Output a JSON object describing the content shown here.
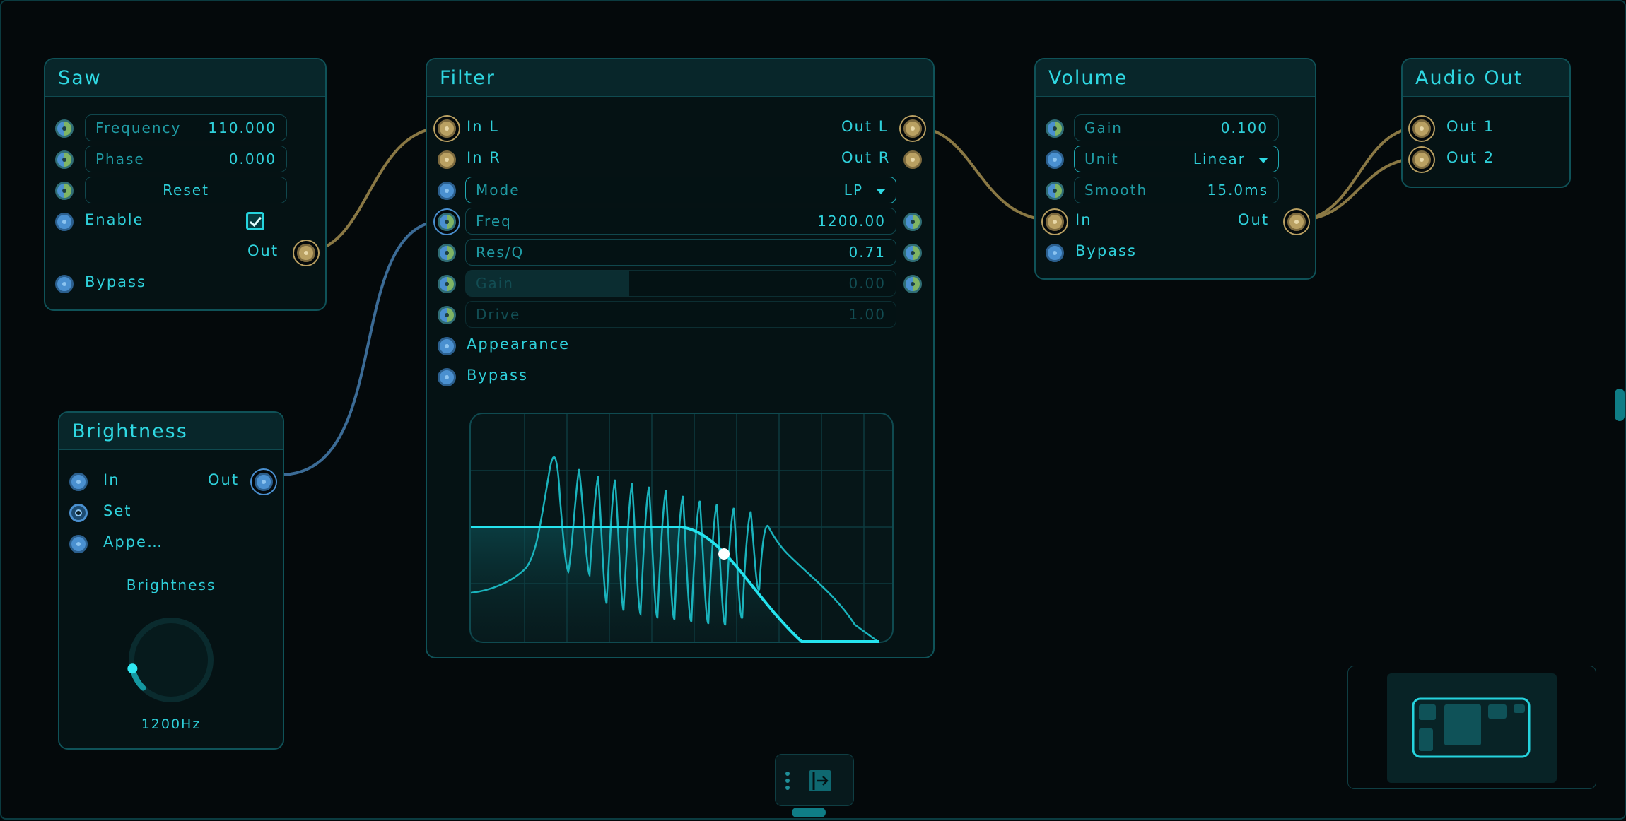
{
  "accent_color": "#25d3dd",
  "wire_colors": {
    "audio": "#8a7844",
    "control": "#3b6b96"
  },
  "nodes": {
    "saw": {
      "title": "Saw",
      "frequency": {
        "label": "Frequency",
        "value": "110.000"
      },
      "phase": {
        "label": "Phase",
        "value": "0.000"
      },
      "reset_label": "Reset",
      "enable_label": "Enable",
      "enable_checked": true,
      "out_label": "Out",
      "bypass_label": "Bypass"
    },
    "filter": {
      "title": "Filter",
      "in_l": "In L",
      "in_r": "In R",
      "out_l": "Out L",
      "out_r": "Out R",
      "mode": {
        "label": "Mode",
        "value": "LP"
      },
      "freq": {
        "label": "Freq",
        "value": "1200.00"
      },
      "res": {
        "label": "Res/Q",
        "value": "0.71"
      },
      "gain": {
        "label": "Gain",
        "value": "0.00"
      },
      "drive": {
        "label": "Drive",
        "value": "1.00"
      },
      "appearance_label": "Appearance",
      "bypass_label": "Bypass"
    },
    "volume": {
      "title": "Volume",
      "gain": {
        "label": "Gain",
        "value": "0.100"
      },
      "unit": {
        "label": "Unit",
        "value": "Linear"
      },
      "smooth": {
        "label": "Smooth",
        "value": "15.0ms"
      },
      "in_label": "In",
      "out_label": "Out",
      "bypass_label": "Bypass"
    },
    "audio_out": {
      "title": "Audio Out",
      "out1": "Out 1",
      "out2": "Out 2"
    },
    "brightness": {
      "title": "Brightness",
      "in_label": "In",
      "out_label": "Out",
      "set_label": "Set",
      "appearance_label": "Appe…",
      "knob_label": "Brightness",
      "knob_value": "1200Hz",
      "knob_fraction": 0.12
    }
  },
  "icons": {
    "toolbar": [
      "drag-handle-icon",
      "exit-panel-icon"
    ],
    "minimap": "minimap-preview"
  }
}
